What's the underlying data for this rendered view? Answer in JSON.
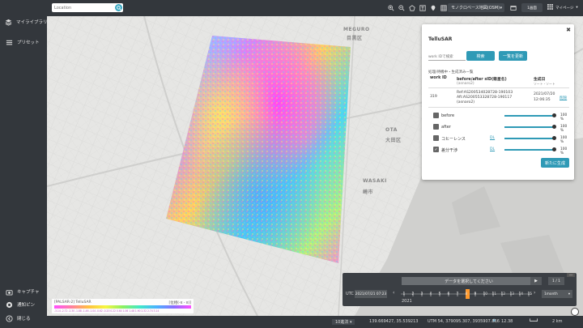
{
  "sidebar": {
    "items": [
      {
        "label": "マイライブラリ",
        "icon": "layers-icon"
      },
      {
        "label": "プリセット",
        "icon": "list-icon"
      }
    ],
    "bottom": [
      {
        "label": "キャプチャ",
        "icon": "camera-icon"
      },
      {
        "label": "通知ピン",
        "icon": "pin-icon"
      },
      {
        "label": "閉じる",
        "icon": "back-icon"
      }
    ]
  },
  "topbar": {
    "search_placeholder": "Location",
    "basemap": "モノクロベース地図(OSM)",
    "screen": "1画面",
    "mypage": "マイページ"
  },
  "map": {
    "labels": [
      "MEGURO",
      "目黒区",
      "OTA",
      "大田区",
      "WASAKI",
      "崎市"
    ]
  },
  "panel": {
    "title": "TelluSAR",
    "work_id_placeholder": "work IDで検索",
    "search_btn": "検索",
    "refresh_btn": "一覧を更新",
    "subtitle": "処理/待機中・生成済み一覧",
    "col_workid": "work ID",
    "col_beforeafter": "before/after sID(衛星名)",
    "col_beforeafter_sub": "(asnaro2)",
    "col_date": "生成日",
    "col_date_sub": "ソート・ソート",
    "row": {
      "work_id": "319",
      "ref": "Ref:AS200534028728-190103",
      "aft": "Aft:AS200553328728-190117",
      "sat": "(asnaro2)",
      "date1": "2021/07/20",
      "date2": "12:06:35",
      "action": "削除"
    },
    "layers": [
      {
        "name": "before",
        "pct": "100 %",
        "dl": "",
        "checked": false
      },
      {
        "name": "after",
        "pct": "100 %",
        "dl": "",
        "checked": false
      },
      {
        "name": "コヒーレンス",
        "pct": "100 %",
        "dl": "DL",
        "checked": false
      },
      {
        "name": "差分干渉",
        "pct": "100 %",
        "dl": "DL",
        "checked": true
      }
    ],
    "generate_btn": "新たに生成"
  },
  "timeline": {
    "data_btn": "データを選択してください",
    "play": "▶",
    "speed": "1 / 1",
    "utc": "UTC",
    "date": "2021/07/21 07:23",
    "range": "1month",
    "year": "2021",
    "ticks": [
      "1",
      "2",
      "3",
      "4",
      "5",
      "6",
      "7",
      "8",
      "9",
      "10",
      "11",
      "12",
      "13",
      "14",
      "15"
    ]
  },
  "legend": {
    "title": "[PALSAR-2] TelluSAR",
    "unit": "[位相(-π - π)]",
    "ticks": "-3.14 -2.72 -2.30 -1.88 -1.46 -1.04 -0.62 -0.20 0.22 0.64 1.06 1.48 1.90 2.32 2.74 3.14"
  },
  "statusbar": {
    "zoom_level": "10進法",
    "coords": "139.669427, 35.539213",
    "utm": "UTM 54, 379095.307, 3935907.856",
    "scale_num": "12.38",
    "scale": "2 km"
  },
  "colors": {
    "accent": "#2f9ab6",
    "sidebar": "#33373c",
    "map_bg": "#e6e6e4",
    "sar_highlight": "#ff4fff",
    "sar_blue": "#4ab0ff"
  }
}
